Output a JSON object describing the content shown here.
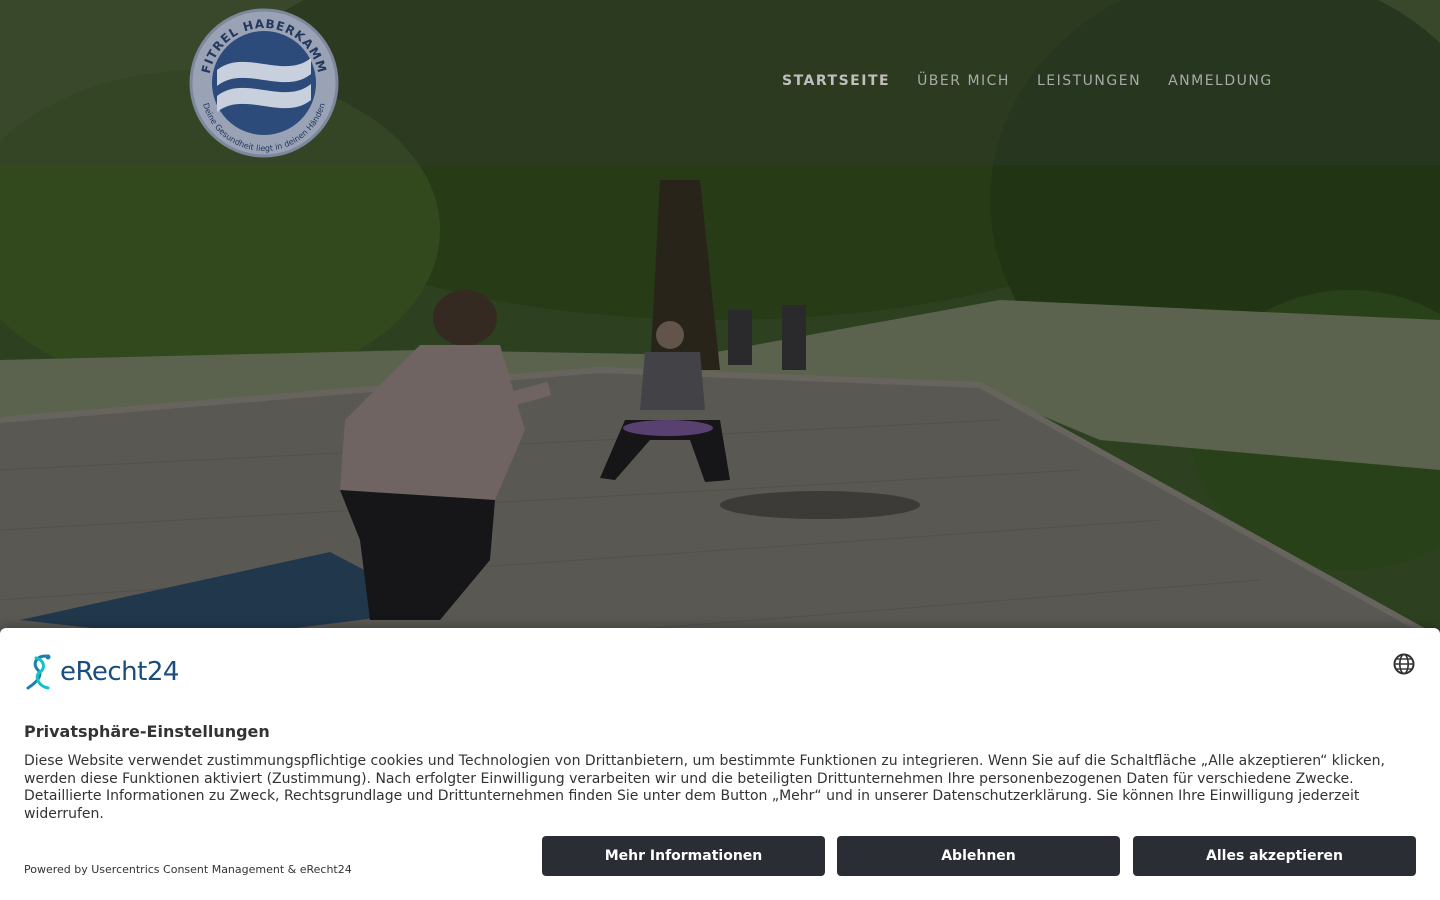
{
  "logo": {
    "top_text": "FITREL HABERKAMM",
    "bottom_text": "Deine Gesundheit liegt in deinen Händen"
  },
  "nav": {
    "items": [
      {
        "label": "STARTSEITE",
        "active": true
      },
      {
        "label": "ÜBER MICH"
      },
      {
        "label": "LEISTUNGEN"
      },
      {
        "label": "ANMELDUNG"
      }
    ]
  },
  "consent": {
    "brand": "eRecht24",
    "icons": {
      "brand": "erecht24-logo-icon",
      "language": "globe-icon"
    },
    "title": "Privatsphäre-Einstellungen",
    "description": "Diese Website verwendet zustimmungspflichtige cookies und Technologien von Drittanbietern, um bestimmte Funktionen zu integrieren. Wenn Sie auf die Schaltfläche „Alle akzeptieren“ klicken, werden diese Funktionen aktiviert (Zustimmung). Nach erfolgter Einwilligung verarbeiten wir und die beteiligten Drittunternehmen Ihre personenbezogenen Daten für verschiedene Zwecke. Detaillierte Informationen zu Zweck, Rechtsgrundlage und Drittunternehmen finden Sie unter dem Button „Mehr“ und in unserer Datenschutzerklärung. Sie können Ihre Einwilligung jederzeit widerrufen.",
    "powered_by": "Powered by Usercentrics Consent Management & eRecht24",
    "buttons": {
      "more": "Mehr Informationen",
      "deny": "Ablehnen",
      "accept": "Alles akzeptieren"
    },
    "colors": {
      "button_bg": "#2a2d33",
      "brand": "#1a4d7c"
    }
  }
}
